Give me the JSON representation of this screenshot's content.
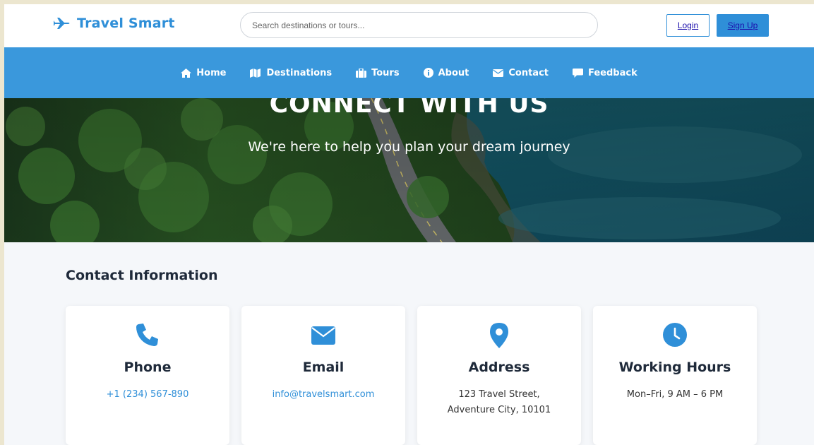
{
  "header": {
    "logo_text": "Travel Smart",
    "search_placeholder": "Search destinations or tours...",
    "login_label": "Login",
    "signup_label": "Sign Up"
  },
  "nav": {
    "items": [
      {
        "label": "Home",
        "icon": "home-icon"
      },
      {
        "label": "Destinations",
        "icon": "map-icon"
      },
      {
        "label": "Tours",
        "icon": "suitcase-icon"
      },
      {
        "label": "About",
        "icon": "info-icon"
      },
      {
        "label": "Contact",
        "icon": "envelope-icon"
      },
      {
        "label": "Feedback",
        "icon": "comment-icon"
      }
    ]
  },
  "hero": {
    "title": "CONNECT WITH US",
    "subtitle": "We're here to help you plan your dream journey"
  },
  "contact": {
    "section_title": "Contact Information",
    "cards": [
      {
        "title": "Phone",
        "value": "+1 (234) 567-890",
        "icon": "phone-icon"
      },
      {
        "title": "Email",
        "value": "info@travelsmart.com",
        "icon": "envelope-icon"
      },
      {
        "title": "Address",
        "line1": "123 Travel Street,",
        "line2": "Adventure City, 10101",
        "icon": "location-pin-icon"
      },
      {
        "title": "Working Hours",
        "value": "Mon–Fri, 9 AM – 6 PM",
        "icon": "clock-icon"
      }
    ]
  },
  "colors": {
    "brand": "#2f8fd8",
    "nav_bg": "#3a98dc",
    "heading": "#1f2a3a"
  }
}
